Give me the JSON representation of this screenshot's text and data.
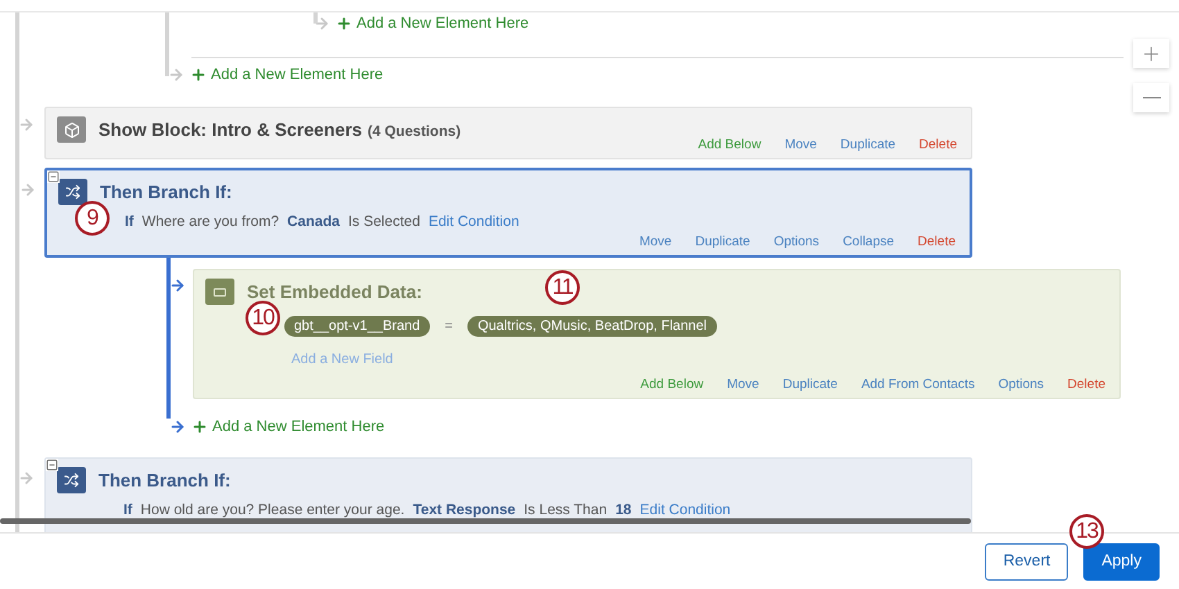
{
  "previous_branch": {
    "inner_add": "Add a New Element Here",
    "outer_add": "Add a New Element Here"
  },
  "elements": [
    {
      "kind": "block",
      "title": "Show Block: Intro & Screeners",
      "count": "(4 Questions)",
      "actions": [
        {
          "label": "Add Below",
          "kind": "add"
        },
        {
          "label": "Move",
          "kind": "link"
        },
        {
          "label": "Duplicate",
          "kind": "link"
        },
        {
          "label": "Delete",
          "kind": "delete"
        }
      ]
    },
    {
      "kind": "branch",
      "selected": true,
      "title": "Then Branch If:",
      "condition": [
        {
          "text": "If",
          "kind": "keyword"
        },
        {
          "text": "Where are you from?",
          "kind": "text"
        },
        {
          "text": "Canada",
          "kind": "value"
        },
        {
          "text": "Is Selected",
          "kind": "text"
        },
        {
          "text": "Edit Condition",
          "kind": "link"
        }
      ],
      "actions": [
        {
          "label": "Move",
          "kind": "link"
        },
        {
          "label": "Duplicate",
          "kind": "link"
        },
        {
          "label": "Options",
          "kind": "link"
        },
        {
          "label": "Collapse",
          "kind": "link"
        },
        {
          "label": "Delete",
          "kind": "delete"
        }
      ],
      "children": [
        {
          "kind": "embedded",
          "title": "Set Embedded Data:",
          "fields": [
            {
              "name": "gbt__opt-v1__Brand",
              "operator": "=",
              "value": "Qualtrics, QMusic, BeatDrop, Flannel"
            }
          ],
          "add_field": "Add a New Field",
          "actions": [
            {
              "label": "Add Below",
              "kind": "add"
            },
            {
              "label": "Move",
              "kind": "link"
            },
            {
              "label": "Duplicate",
              "kind": "link"
            },
            {
              "label": "Add From Contacts",
              "kind": "link"
            },
            {
              "label": "Options",
              "kind": "link"
            },
            {
              "label": "Delete",
              "kind": "delete"
            }
          ]
        }
      ],
      "add": "Add a New Element Here"
    },
    {
      "kind": "branch",
      "selected": false,
      "title": "Then Branch If:",
      "condition": [
        {
          "text": "If",
          "kind": "keyword"
        },
        {
          "text": "How old are you? Please enter your age.",
          "kind": "text"
        },
        {
          "text": "Text Response",
          "kind": "value"
        },
        {
          "text": "Is Less Than",
          "kind": "text"
        },
        {
          "text": "18",
          "kind": "value"
        },
        {
          "text": "Edit Condition",
          "kind": "link"
        }
      ]
    }
  ],
  "callouts": [
    {
      "label": "9"
    },
    {
      "label": "10"
    },
    {
      "label": "11"
    },
    {
      "label": "13"
    }
  ],
  "footer_buttons": [
    {
      "label": "Revert",
      "kind": "secondary"
    },
    {
      "label": "Apply",
      "kind": "primary"
    }
  ]
}
